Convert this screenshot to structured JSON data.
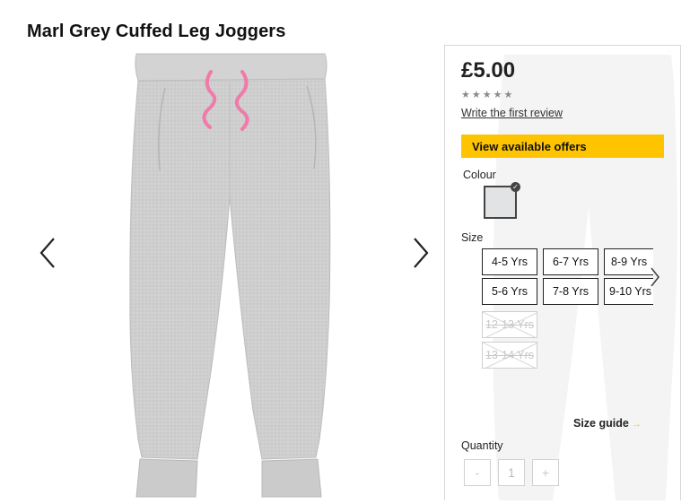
{
  "product": {
    "title": "Marl Grey Cuffed Leg Joggers",
    "price": "£5.00",
    "review_link": "Write the first review",
    "rating_stars": 0,
    "offers_button": "View available offers",
    "colour_label": "Colour",
    "selected_colour": "#e2e3e5",
    "size_label": "Size",
    "sizes": [
      {
        "label": "4-5 Yrs",
        "available": true
      },
      {
        "label": "6-7 Yrs",
        "available": true
      },
      {
        "label": "8-9 Yrs",
        "available": true
      },
      {
        "label": "5-6 Yrs",
        "available": true
      },
      {
        "label": "7-8 Yrs",
        "available": true
      },
      {
        "label": "9-10 Yrs",
        "available": true
      },
      {
        "label": "12-13 Yrs",
        "available": false
      },
      {
        "label": "13-14 Yrs",
        "available": false
      }
    ],
    "size_guide": "Size guide",
    "quantity_label": "Quantity",
    "quantity_value": "1",
    "minus": "-",
    "plus": "+"
  },
  "icons": {
    "prev": "chevron-left-icon",
    "next": "chevron-right-icon",
    "size_next": "chevron-right-icon",
    "swatch_selected": "check-icon",
    "star": "star-icon",
    "size_guide_arrow": "arrow-right-icon"
  },
  "colors": {
    "accent": "#ffc400",
    "trouser": "#cdcdcd",
    "drawstring": "#f07aa8"
  }
}
